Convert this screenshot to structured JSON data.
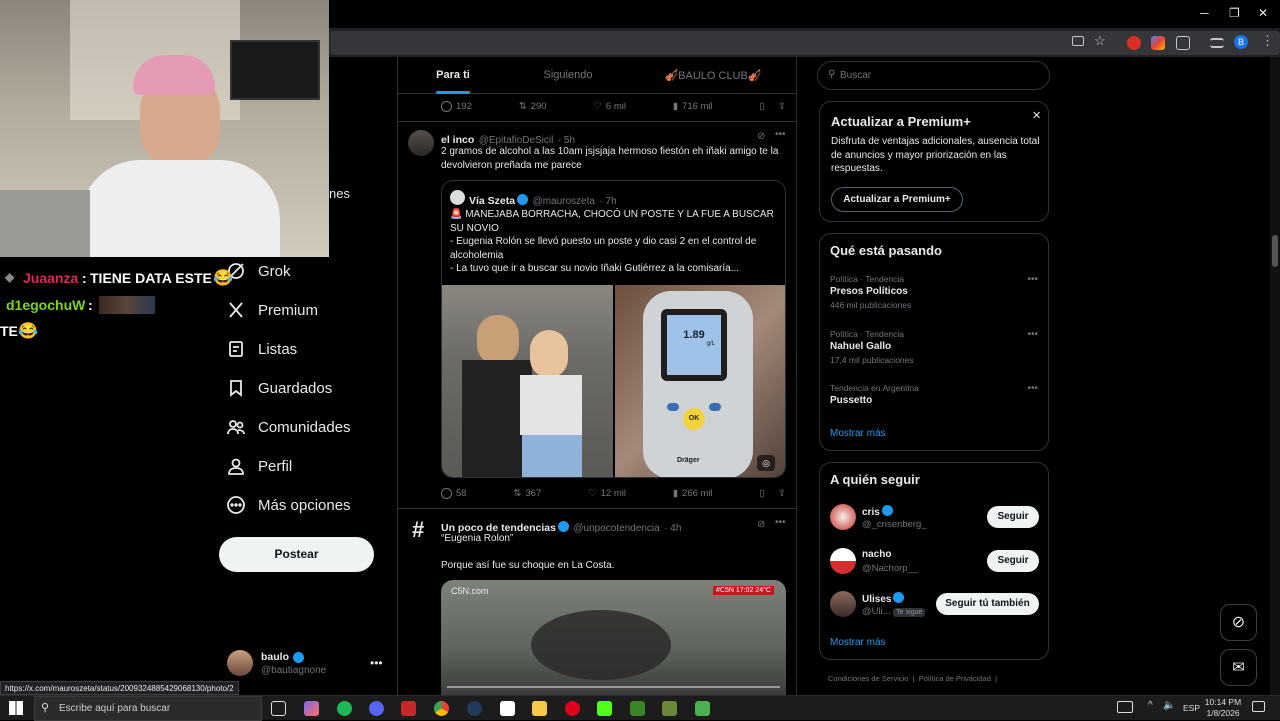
{
  "browser": {
    "tab_title": "",
    "url": "",
    "status_url": "https://x.com/mauroszeta/status/2009324885429068130/photo/2",
    "profile_letter": "B"
  },
  "webcam": {
    "chat": [
      {
        "user": "Juaanza",
        "sep": ":",
        "text": "TIENE DATA ESTE",
        "color": "#e0245e"
      },
      {
        "user": "d1egochuW",
        "sep": ":",
        "text": "",
        "color": "#7ed321"
      },
      {
        "user": "",
        "sep": "",
        "text": "TE",
        "color": "#ffffff"
      }
    ],
    "partial_label": "nes"
  },
  "sidebar": {
    "items": [
      {
        "label": "Grok",
        "icon": "grok-icon"
      },
      {
        "label": "Premium",
        "icon": "x-logo-icon"
      },
      {
        "label": "Listas",
        "icon": "list-icon"
      },
      {
        "label": "Guardados",
        "icon": "bookmark-icon"
      },
      {
        "label": "Comunidades",
        "icon": "communities-icon"
      },
      {
        "label": "Perfil",
        "icon": "profile-icon"
      },
      {
        "label": "Más opciones",
        "icon": "more-circle-icon"
      }
    ],
    "post_button": "Postear",
    "account": {
      "name": "baulo",
      "handle": "@bautiagnone"
    }
  },
  "feed": {
    "tabs": [
      "Para ti",
      "Siguiendo",
      "🎻BAULO CLUB🎻"
    ],
    "top_actions": {
      "replies": "192",
      "reposts": "290",
      "likes": "6 mil",
      "views": "716 mil"
    },
    "tweet1": {
      "name": "el inco",
      "handle": "@EpitafioDeSicil",
      "time": "· 5h",
      "text": "2 gramos de alcohol a las 10am jsjsjaja hermoso fiestón eh iñaki amigo te la devolvieron preñada me parece",
      "quote": {
        "name": "Vía Szeta",
        "handle": "@mauroszeta",
        "time": "· 7h",
        "lines": [
          "🚨 MANEJABA BORRACHA, CHOCÓ UN POSTE Y LA FUE A BUSCAR SU NOVIO",
          "- Eugenia Rolón se llevó puesto un poste y dio casi 2 en el control de alcoholemia",
          "- La tuvo que ir a buscar su novio Iñaki Gutiérrez a la comisaría..."
        ],
        "breathalyzer_reading": "1.89",
        "breathalyzer_unit": "g/L",
        "breathalyzer_ok": "OK",
        "breathalyzer_brand": "Dräger"
      },
      "actions": {
        "replies": "58",
        "reposts": "367",
        "likes": "12 mil",
        "views": "266 mil"
      }
    },
    "tweet2": {
      "name": "Un poco de tendencias",
      "handle": "@unpocotendencia",
      "time": "· 4h",
      "line1": "“Eugenia Rolon”",
      "line2": "Porque así fue su choque en La Costa.",
      "video_watermark": "C5N.com",
      "video_badge": "#C5N 17:02 24°C"
    }
  },
  "right": {
    "search_placeholder": "Buscar",
    "premium": {
      "title": "Actualizar a Premium+",
      "body": "Disfruta de ventajas adicionales, ausencia total de anuncios y mayor priorización en las respuestas.",
      "button": "Actualizar a Premium+"
    },
    "trends": {
      "title": "Qué está pasando",
      "items": [
        {
          "category": "Política · Tendencia",
          "name": "Presos Políticos",
          "count": "446 mil publicaciones"
        },
        {
          "category": "Política · Tendencia",
          "name": "Nahuel Gallo",
          "count": "17,4 mil publicaciones"
        },
        {
          "category": "Tendencia en Argentina",
          "name": "Pussetto",
          "count": ""
        }
      ],
      "more": "Mostrar más"
    },
    "follow": {
      "title": "A quién seguir",
      "items": [
        {
          "name": "cris",
          "handle": "@_crisenberg_",
          "button": "Seguir",
          "badge": ""
        },
        {
          "name": "nacho",
          "handle": "@Nachorp__",
          "button": "Seguir",
          "badge": ""
        },
        {
          "name": "Ulises",
          "handle": "@Uli...",
          "button": "Seguir tú también",
          "badge": "Te sigue"
        }
      ],
      "more": "Mostrar más"
    },
    "footer": [
      "Condiciones de Servicio",
      "|",
      "Política de Privacidad",
      "|"
    ]
  },
  "taskbar": {
    "search_placeholder": "Escribe aquí para buscar",
    "lang": "ESP",
    "time": "10:14 PM",
    "date": "1/8/2026"
  }
}
